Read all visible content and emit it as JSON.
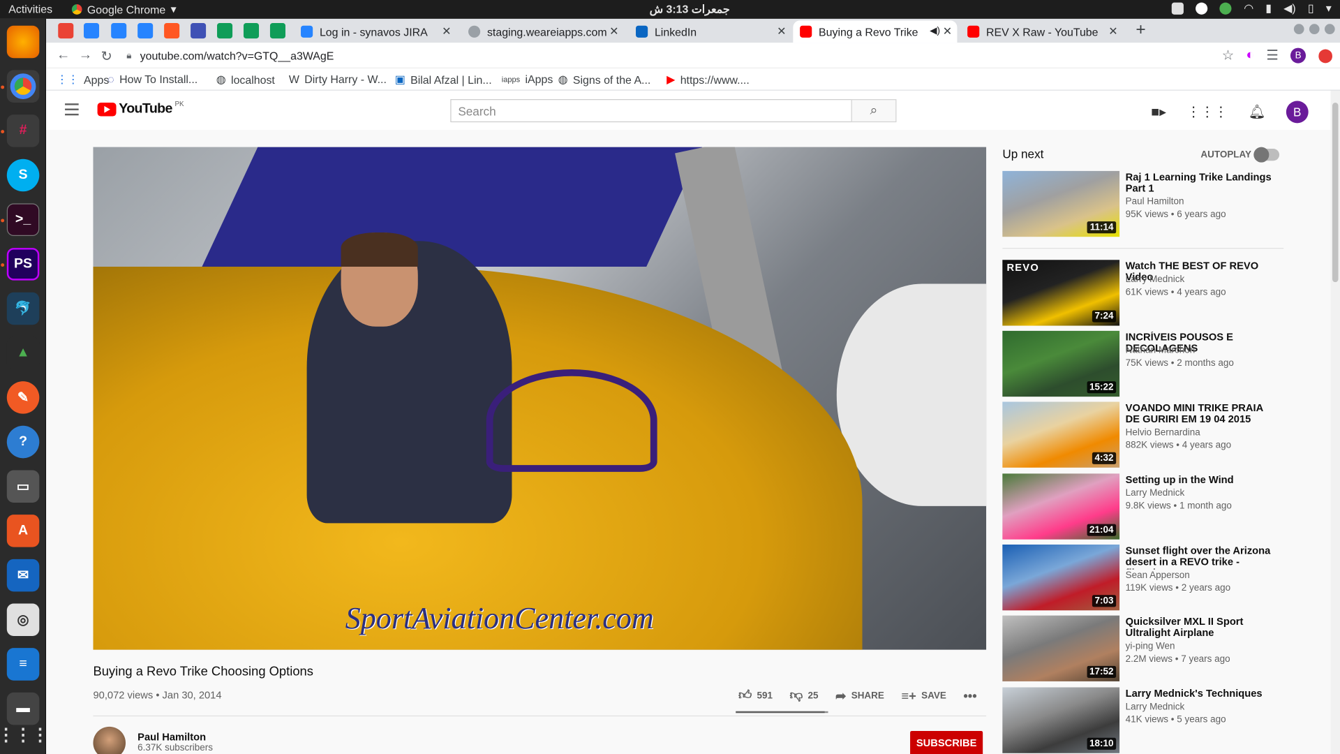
{
  "os": {
    "activities": "Activities",
    "app_name": "Google Chrome",
    "clock": "جمعرات 3:13 ش"
  },
  "browser": {
    "tabs": [
      {
        "title": "Log in - synavos JIRA"
      },
      {
        "title": "staging.weareiapps.com"
      },
      {
        "title": "LinkedIn"
      },
      {
        "title": "Buying a Revo Trike Ch"
      },
      {
        "title": "REV X Raw - YouTube"
      }
    ],
    "url": "youtube.com/watch?v=GTQ__a3WAgE",
    "bookmarks": [
      {
        "label": "Apps"
      },
      {
        "label": "How To Install..."
      },
      {
        "label": "localhost"
      },
      {
        "label": "Dirty Harry - W..."
      },
      {
        "label": "Bilal Afzal | Lin..."
      },
      {
        "label": "iApps"
      },
      {
        "label": "Signs of the A..."
      },
      {
        "label": "https://www...."
      }
    ],
    "profile_initial": "B"
  },
  "youtube": {
    "logo_text": "YouTube",
    "country": "PK",
    "search_placeholder": "Search",
    "avatar_initial": "B",
    "video": {
      "watermark": "SportAviationCenter.com",
      "title": "Buying a Revo Trike Choosing Options",
      "meta": "90,072 views • Jan 30, 2014",
      "likes": "591",
      "dislikes": "25",
      "share": "SHARE",
      "save": "SAVE",
      "like_ratio": 0.96
    },
    "channel": {
      "name": "Paul Hamilton",
      "subscribers": "6.37K subscribers",
      "subscribe": "SUBSCRIBE"
    },
    "upnext": {
      "heading": "Up next",
      "autoplay": "AUTOPLAY",
      "videos": [
        {
          "title": "Raj 1 Learning Trike Landings Part 1",
          "channel": "Paul Hamilton",
          "meta": "95K views • 6 years ago",
          "duration": "11:14"
        },
        {
          "title": "Watch THE BEST OF REVO Video",
          "channel": "Larry Mednick",
          "meta": "61K views • 4 years ago",
          "duration": "7:24",
          "thumb_text": "REVO"
        },
        {
          "title": "INCRÍVEIS POUSOS E DECOLAGENS",
          "channel": "Nathan Marchon",
          "meta": "75K views • 2 months ago",
          "duration": "15:22"
        },
        {
          "title": "VOANDO MINI TRIKE PRAIA DE GURIRI EM 19 04 2015",
          "channel": "Helvio Bernardina",
          "meta": "882K views • 4 years ago",
          "duration": "4:32"
        },
        {
          "title": "Setting up in the Wind",
          "channel": "Larry Mednick",
          "meta": "9.8K views • 1 month ago",
          "duration": "21:04"
        },
        {
          "title": "Sunset flight over the Arizona desert in a REVO trike - filmed...",
          "channel": "Sean Apperson",
          "meta": "119K views • 2 years ago",
          "duration": "7:03"
        },
        {
          "title": "Quicksilver MXL II Sport Ultralight Airplane",
          "channel": "yi-ping Wen",
          "meta": "2.2M views • 7 years ago",
          "duration": "17:52"
        },
        {
          "title": "Larry Mednick's Techniques",
          "channel": "Larry Mednick",
          "meta": "41K views • 5 years ago",
          "duration": "18:10"
        }
      ]
    }
  }
}
